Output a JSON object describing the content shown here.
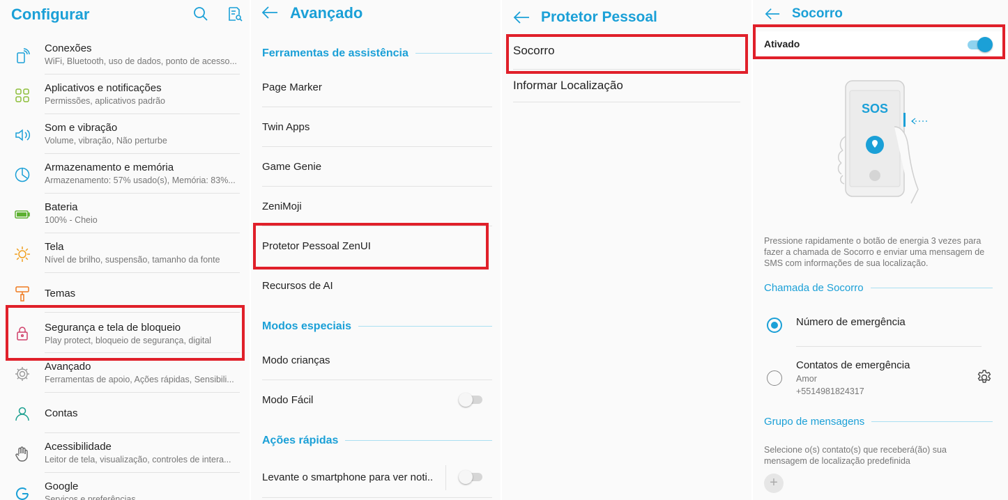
{
  "colors": {
    "accent": "#1ba0d7",
    "highlight": "#e0202a"
  },
  "panel1": {
    "title": "Configurar",
    "icons": [
      "search-icon",
      "search-settings-icon"
    ],
    "items": [
      {
        "title": "Conexões",
        "subtitle": "WiFi, Bluetooth, uso de dados, ponto de acesso...",
        "icon": "connections-icon"
      },
      {
        "title": "Aplicativos e notificações",
        "subtitle": "Permissões, aplicativos padrão",
        "icon": "apps-icon"
      },
      {
        "title": "Som e vibração",
        "subtitle": "Volume, vibração, Não perturbe",
        "icon": "sound-icon"
      },
      {
        "title": "Armazenamento e memória",
        "subtitle": "Armazenamento: 57% usado(s), Memória: 83%...",
        "icon": "storage-icon"
      },
      {
        "title": "Bateria",
        "subtitle": "100% - Cheio",
        "icon": "battery-icon"
      },
      {
        "title": "Tela",
        "subtitle": "Nível de brilho, suspensão, tamanho da fonte",
        "icon": "display-icon"
      },
      {
        "title": "Temas",
        "subtitle": "",
        "icon": "themes-icon"
      },
      {
        "title": "Segurança e tela de bloqueio",
        "subtitle": "Play protect, bloqueio de segurança, digital",
        "icon": "lock-icon"
      },
      {
        "title": "Avançado",
        "subtitle": "Ferramentas de apoio, Ações rápidas, Sensibili...",
        "icon": "advanced-gear-icon"
      },
      {
        "title": "Contas",
        "subtitle": "",
        "icon": "account-icon"
      },
      {
        "title": "Acessibilidade",
        "subtitle": "Leitor de tela, visualização, controles de intera...",
        "icon": "accessibility-hand-icon"
      },
      {
        "title": "Google",
        "subtitle": "Serviços e preferências",
        "icon": "google-icon"
      }
    ]
  },
  "panel2": {
    "title": "Avançado",
    "sections": [
      {
        "label": "Ferramentas de assistência"
      },
      {
        "label": "Modos especiais"
      },
      {
        "label": "Ações rápidas"
      }
    ],
    "items": [
      {
        "title": "Page Marker"
      },
      {
        "title": "Twin Apps"
      },
      {
        "title": "Game Genie"
      },
      {
        "title": "ZeniMoji"
      },
      {
        "title": "Protetor Pessoal ZenUI"
      },
      {
        "title": "Recursos de AI"
      },
      {
        "title": "Modo crianças"
      },
      {
        "title": "Modo Fácil",
        "toggle": false
      },
      {
        "title": "Levante o smartphone para ver noti..",
        "toggle": false
      }
    ]
  },
  "panel3": {
    "title": "Protetor Pessoal",
    "items": [
      {
        "title": "Socorro"
      },
      {
        "title": "Informar Localização"
      }
    ]
  },
  "panel4": {
    "title": "Socorro",
    "enabled_label": "Ativado",
    "enabled": true,
    "illustration_text": "SOS",
    "description": "Pressione rapidamente o botão de energia 3 vezes para fazer a chamada de Socorro e enviar uma mensagem de SMS com informações de sua localização.",
    "section_call": "Chamada de Socorro",
    "option_emergency_number": "Número de emergência",
    "option_emergency_contacts": "Contatos de emergência",
    "contact_name": "Amor",
    "contact_phone": "+5514981824317",
    "selected_option": "Número de emergência",
    "section_group": "Grupo de mensagens",
    "group_description": "Selecione o(s) contato(s) que receberá(ão) sua mensagem de localização predefinida"
  }
}
